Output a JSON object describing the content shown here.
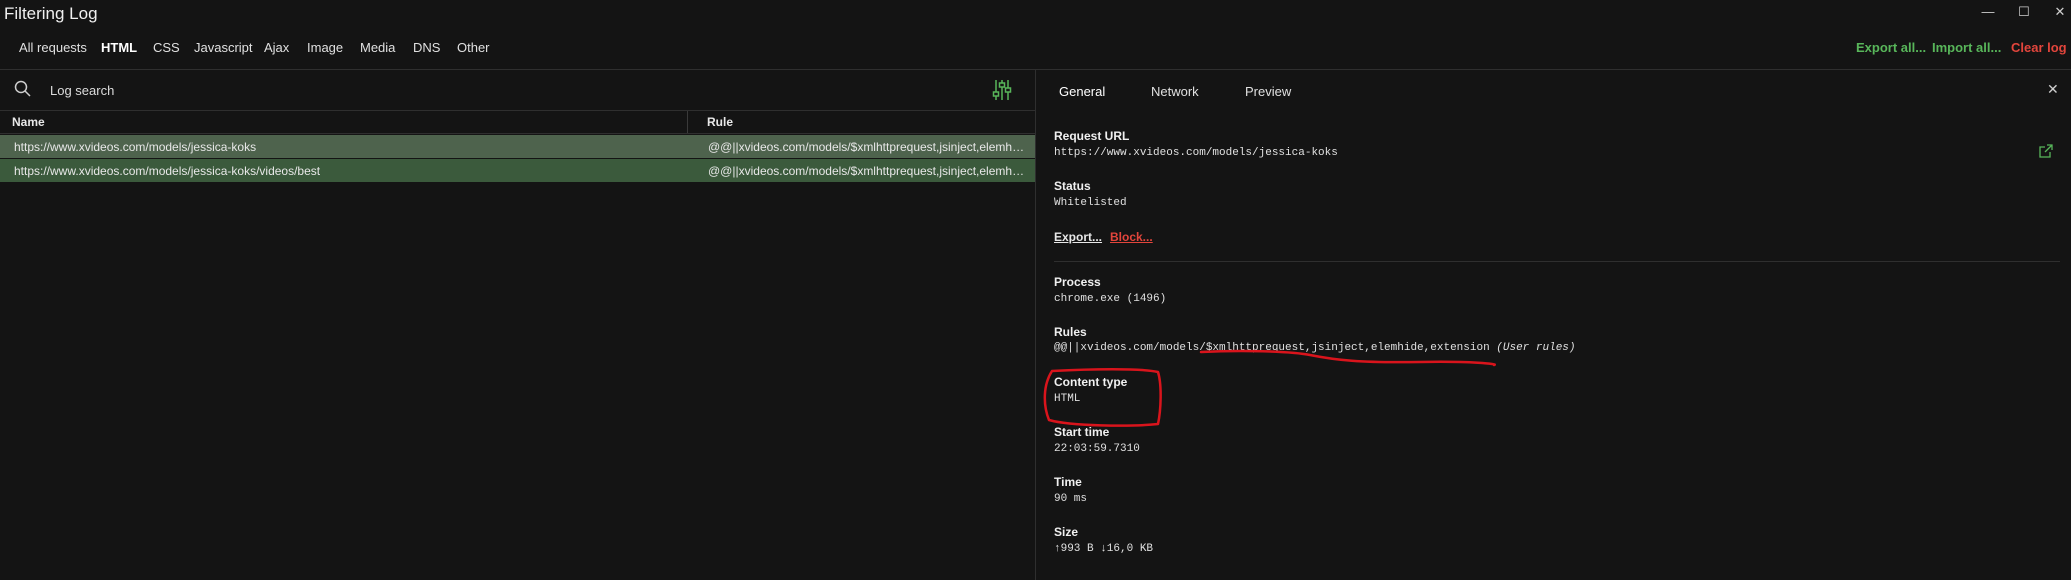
{
  "window": {
    "title": "Filtering Log",
    "minimize_glyph": "—",
    "maximize_glyph": "☐",
    "close_glyph": "✕"
  },
  "filters": {
    "tabs": [
      "All requests",
      "HTML",
      "CSS",
      "Javascript",
      "Ajax",
      "Image",
      "Media",
      "DNS",
      "Other"
    ],
    "active": "HTML"
  },
  "actions": {
    "export_all": "Export all...",
    "import_all": "Import all...",
    "clear_log": "Clear log"
  },
  "search": {
    "placeholder": "Log search",
    "value": ""
  },
  "table": {
    "columns": [
      "Name",
      "Rule"
    ],
    "rows": [
      {
        "name": "https://www.xvideos.com/models/jessica-koks",
        "rule": "@@||xvideos.com/models/$xmlhttprequest,jsinject,elemhide,extension"
      },
      {
        "name": "https://www.xvideos.com/models/jessica-koks/videos/best",
        "rule": "@@||xvideos.com/models/$xmlhttprequest,jsinject,elemhide,extension"
      }
    ]
  },
  "details": {
    "tabs": [
      "General",
      "Network",
      "Preview"
    ],
    "active_tab": "General",
    "close_glyph": "✕",
    "request_url": {
      "label": "Request URL",
      "value": "https://www.xvideos.com/models/jessica-koks"
    },
    "status": {
      "label": "Status",
      "value": "Whitelisted"
    },
    "links": {
      "export": "Export...",
      "block": "Block..."
    },
    "process": {
      "label": "Process",
      "value": "chrome.exe (1496)"
    },
    "rules": {
      "label": "Rules",
      "value": "@@||xvideos.com/models/$xmlhttprequest,jsinject,elemhide,extension",
      "note": "(User rules)"
    },
    "content_type": {
      "label": "Content type",
      "value": "HTML"
    },
    "start_time": {
      "label": "Start time",
      "value": "22:03:59.7310"
    },
    "time": {
      "label": "Time",
      "value": "90 ms"
    },
    "size": {
      "label": "Size",
      "value": "↑993 B ↓16,0 KB"
    }
  },
  "colors": {
    "background": "#141414",
    "row_selected": "#4e634d",
    "row_other": "#3b5a3c",
    "accent_green": "#58b65a",
    "accent_red": "#e2453c",
    "annotation_red": "#d9141c"
  }
}
